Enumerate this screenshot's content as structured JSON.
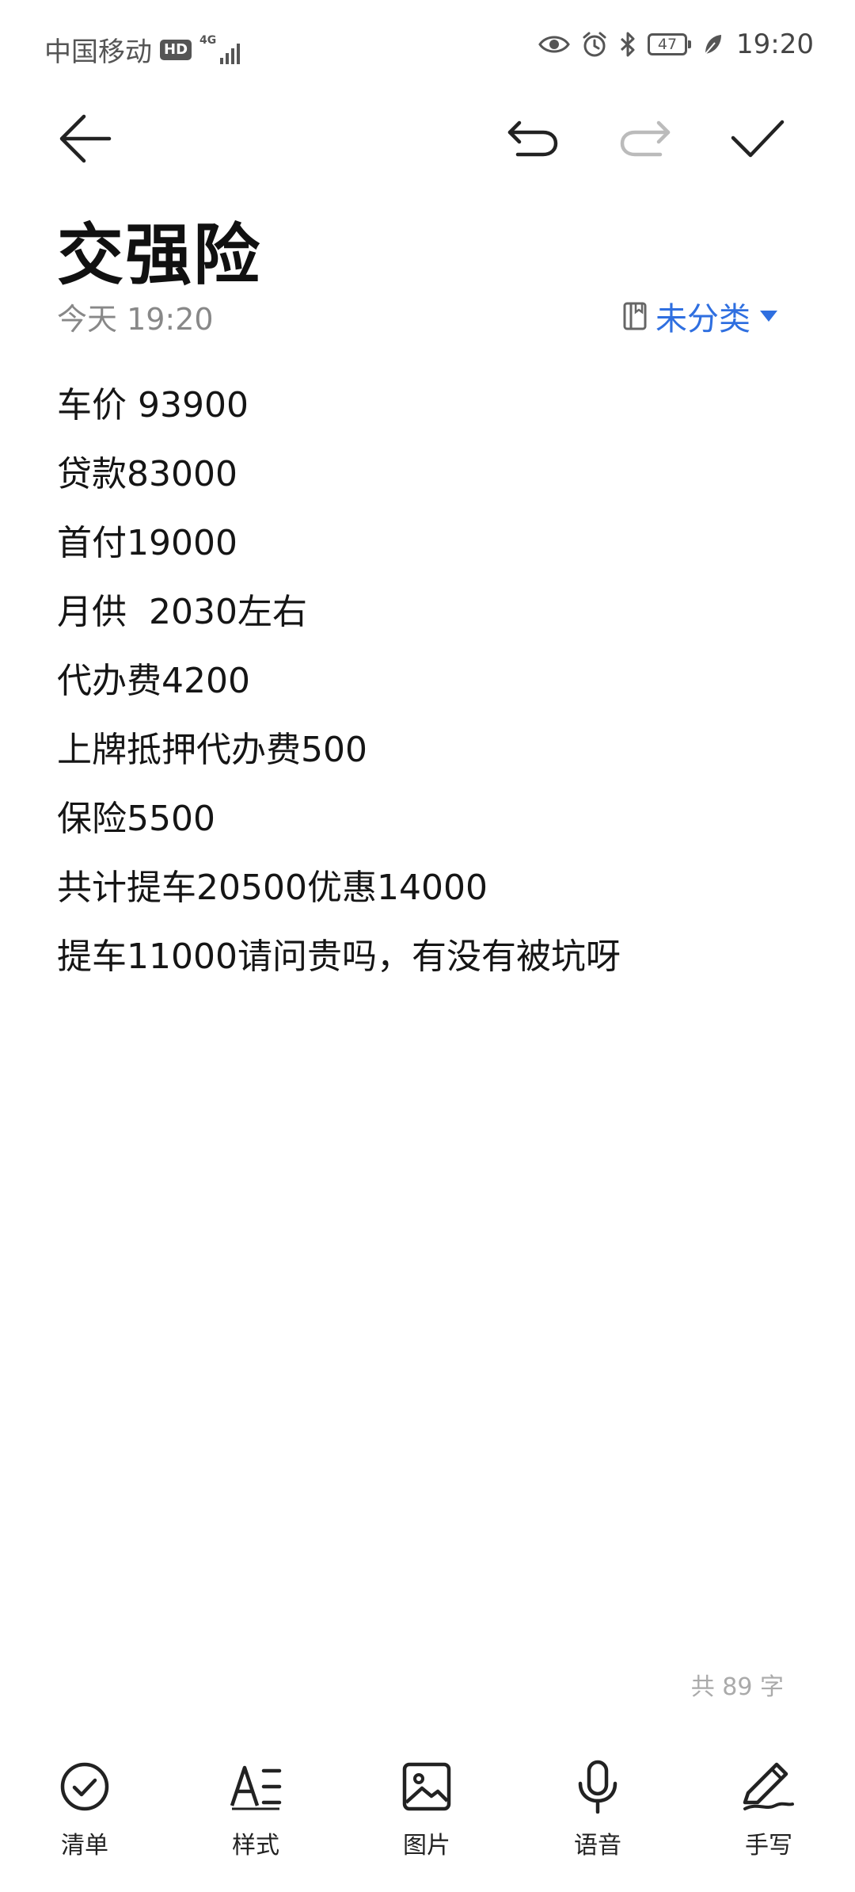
{
  "status_bar": {
    "carrier": "中国移动",
    "hd": "HD",
    "network": "4G",
    "battery": "47",
    "time": "19:20"
  },
  "toolbar": {
    "back_icon": "arrow-left-icon",
    "undo_icon": "undo-icon",
    "redo_icon": "redo-icon",
    "done_icon": "checkmark-icon"
  },
  "note": {
    "title": "交强险",
    "date": "今天 19:20",
    "category": "未分类",
    "lines": [
      "车价 93900",
      "贷款83000",
      "首付19000",
      "月供  2030左右",
      "代办费4200",
      "上牌抵押代办费500",
      "保险5500",
      "共计提车20500优惠14000",
      "提车11000请问贵吗，有没有被坑呀"
    ],
    "word_count": "共 89 字"
  },
  "bottom_tools": [
    {
      "label": "清单",
      "icon": "checklist-icon"
    },
    {
      "label": "样式",
      "icon": "text-style-icon"
    },
    {
      "label": "图片",
      "icon": "image-icon"
    },
    {
      "label": "语音",
      "icon": "microphone-icon"
    },
    {
      "label": "手写",
      "icon": "pen-icon"
    }
  ],
  "colors": {
    "accent": "#2f6fe0",
    "text": "#111111",
    "muted": "#888888"
  }
}
